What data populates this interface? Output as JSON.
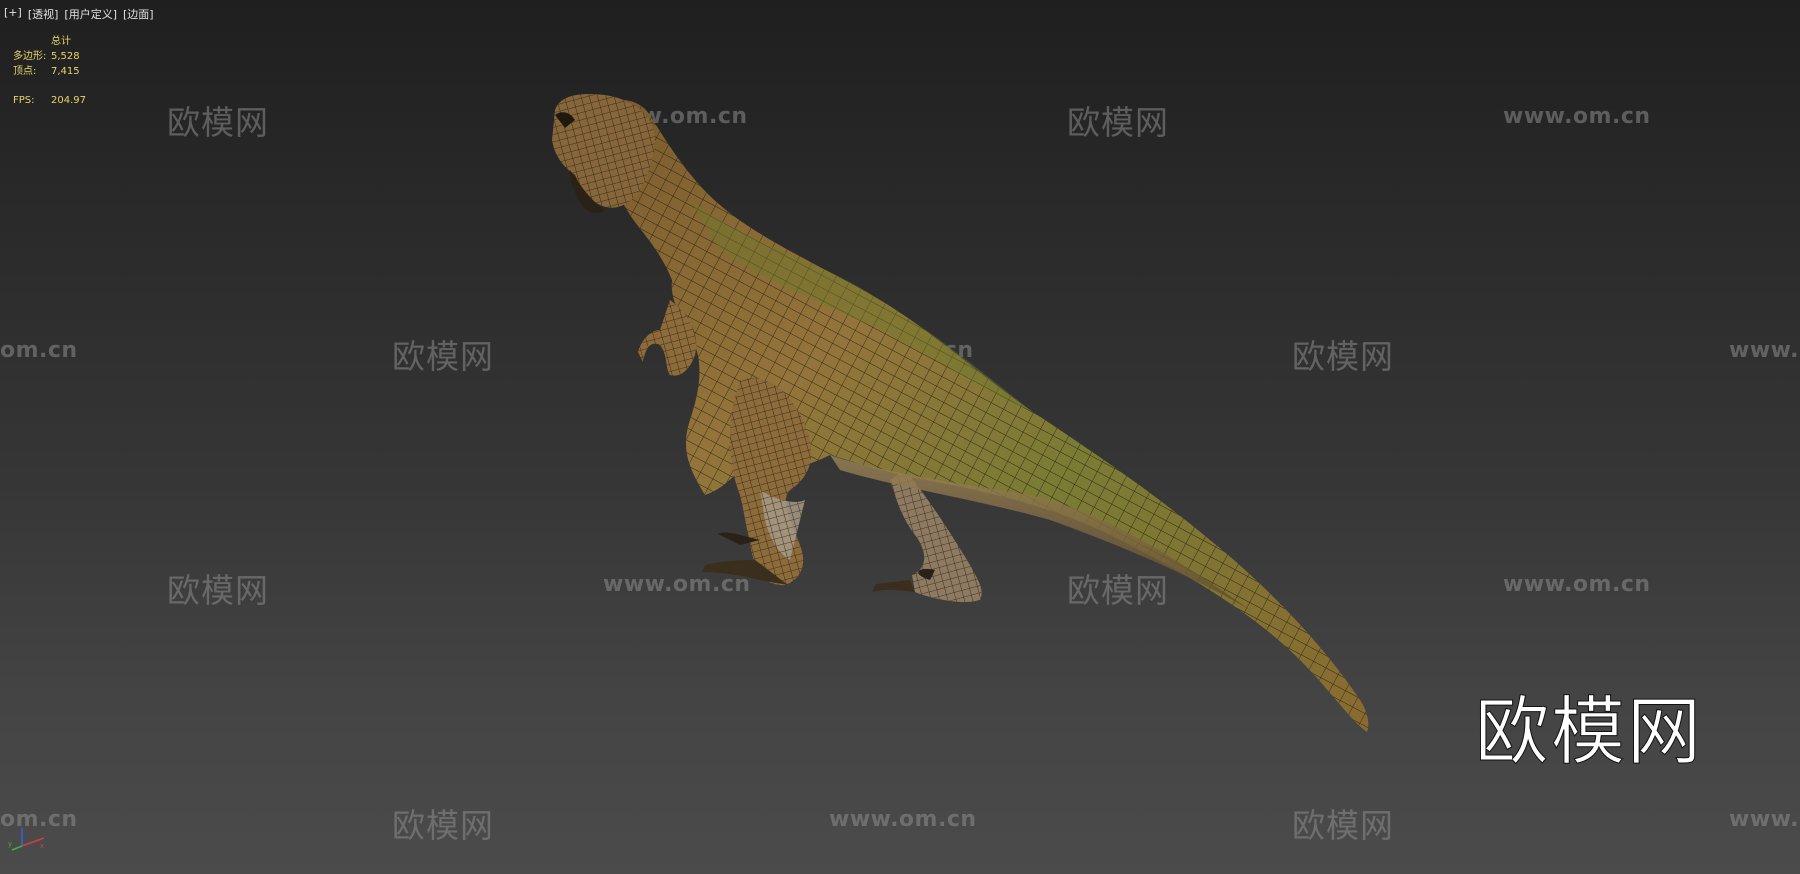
{
  "viewport": {
    "menus": [
      "[+]",
      "[透视]",
      "[用户定义]",
      "[边面]"
    ]
  },
  "stats": {
    "header": "总计",
    "polygons_label": "多边形:",
    "polygons_value": "5,528",
    "vertices_label": "顶点:",
    "vertices_value": "7,415",
    "fps_label": "FPS:",
    "fps_value": "204.97"
  },
  "watermarks": {
    "cn_text": "欧模网",
    "url_text": "www.om.cn",
    "url_partial_left": "om.cn",
    "url_partial_right": "www."
  },
  "brand": {
    "logo_text": "欧模网"
  },
  "colors": {
    "background_top": "#1f1f1f",
    "background_bottom": "#4b4b4b",
    "stats_text": "#e8d36a",
    "skin_base": "#8a6a34",
    "skin_green": "#6e7a30",
    "wire": "#1d1a10"
  },
  "icons": {
    "axis_gizmo": "axis-gizmo-icon"
  }
}
